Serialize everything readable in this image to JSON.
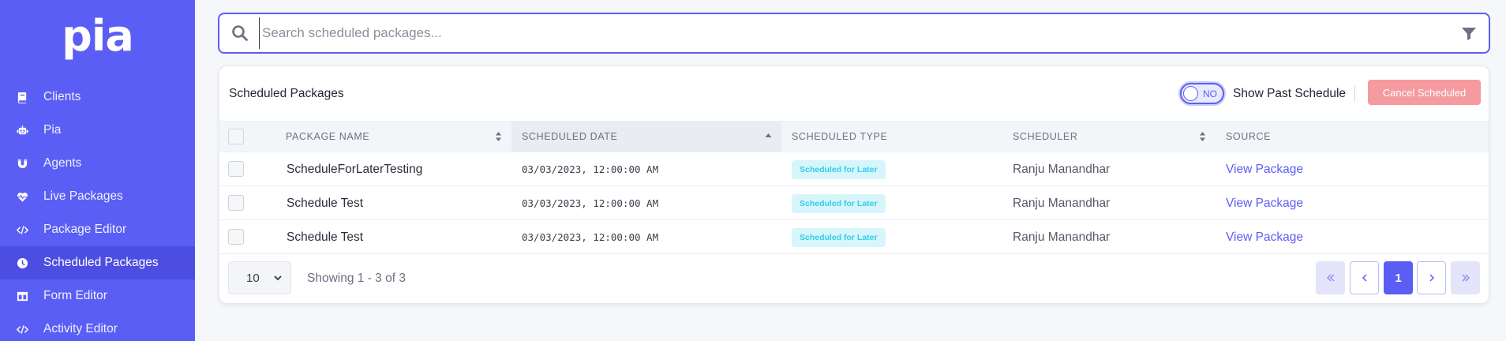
{
  "app": {
    "logo": "pia"
  },
  "sidebar": {
    "items": [
      {
        "label": "Clients",
        "icon": "book-icon"
      },
      {
        "label": "Pia",
        "icon": "robot-icon"
      },
      {
        "label": "Agents",
        "icon": "magnet-icon"
      },
      {
        "label": "Live Packages",
        "icon": "heartbeat-icon"
      },
      {
        "label": "Package Editor",
        "icon": "code-icon"
      },
      {
        "label": "Scheduled Packages",
        "icon": "clock-icon",
        "active": true
      },
      {
        "label": "Form Editor",
        "icon": "table-icon"
      },
      {
        "label": "Activity Editor",
        "icon": "code-icon"
      }
    ]
  },
  "search": {
    "placeholder": "Search scheduled packages..."
  },
  "panel": {
    "title": "Scheduled Packages",
    "toggle_state": "NO",
    "toggle_label": "Show Past Schedule",
    "cancel_label": "Cancel Scheduled"
  },
  "table": {
    "headers": {
      "package_name": "PACKAGE NAME",
      "scheduled_date": "SCHEDULED DATE",
      "scheduled_type": "SCHEDULED TYPE",
      "scheduler": "SCHEDULER",
      "source": "SOURCE"
    },
    "rows": [
      {
        "package_name": "ScheduleForLaterTesting",
        "scheduled_date": "03/03/2023, 12:00:00 AM",
        "scheduled_type": "Scheduled for Later",
        "scheduler": "Ranju Manandhar",
        "source": "View Package"
      },
      {
        "package_name": "Schedule Test",
        "scheduled_date": "03/03/2023, 12:00:00 AM",
        "scheduled_type": "Scheduled for Later",
        "scheduler": "Ranju Manandhar",
        "source": "View Package"
      },
      {
        "package_name": "Schedule Test",
        "scheduled_date": "03/03/2023, 12:00:00 AM",
        "scheduled_type": "Scheduled for Later",
        "scheduler": "Ranju Manandhar",
        "source": "View Package"
      }
    ]
  },
  "pagination": {
    "page_size": "10",
    "showing": "Showing 1 - 3 of 3",
    "current_page": "1"
  },
  "colors": {
    "accent": "#5b5ef4",
    "sidebar_active": "#4b4ee0",
    "danger_disabled": "#f59a9f",
    "badge_bg": "#d6f6fb",
    "badge_text": "#33cde8"
  }
}
